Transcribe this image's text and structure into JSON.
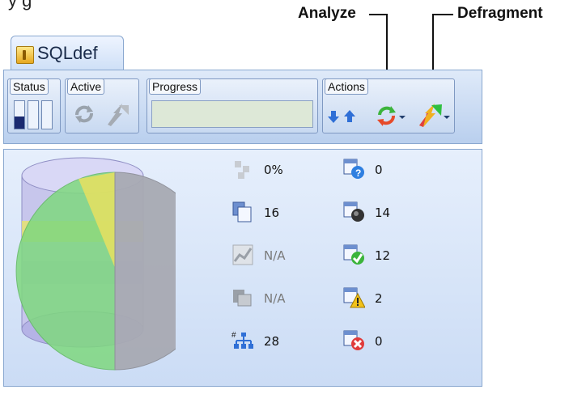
{
  "caption_fragment": "y            g",
  "callouts": {
    "analyze": "Analyze",
    "defragment": "Defragment"
  },
  "tab": {
    "title": "SQLdef",
    "icon": "database-lock-icon"
  },
  "toolbar": {
    "status_label": "Status",
    "active_label": "Active",
    "progress_label": "Progress",
    "actions_label": "Actions",
    "status_level": 0.33,
    "progress_value": ""
  },
  "stats_left": [
    {
      "icon": "fragment-percent-icon",
      "value": "0%",
      "dim": false
    },
    {
      "icon": "pages-icon",
      "value": "16",
      "dim": false
    },
    {
      "icon": "chart-icon",
      "value": "N/A",
      "dim": true
    },
    {
      "icon": "copies-icon",
      "value": "N/A",
      "dim": true
    },
    {
      "icon": "index-tree-icon",
      "value": "28",
      "dim": false
    }
  ],
  "stats_right": [
    {
      "icon": "unknown-status-icon",
      "value": "0"
    },
    {
      "icon": "running-status-icon",
      "value": "14"
    },
    {
      "icon": "ok-status-icon",
      "value": "12"
    },
    {
      "icon": "warning-status-icon",
      "value": "2"
    },
    {
      "icon": "error-status-icon",
      "value": "0"
    }
  ],
  "colors": {
    "pie_gray": "#a8aab3",
    "pie_green": "#7fd87f",
    "pie_yellow": "#e8e060",
    "db_purple": "#b5b3e6"
  }
}
